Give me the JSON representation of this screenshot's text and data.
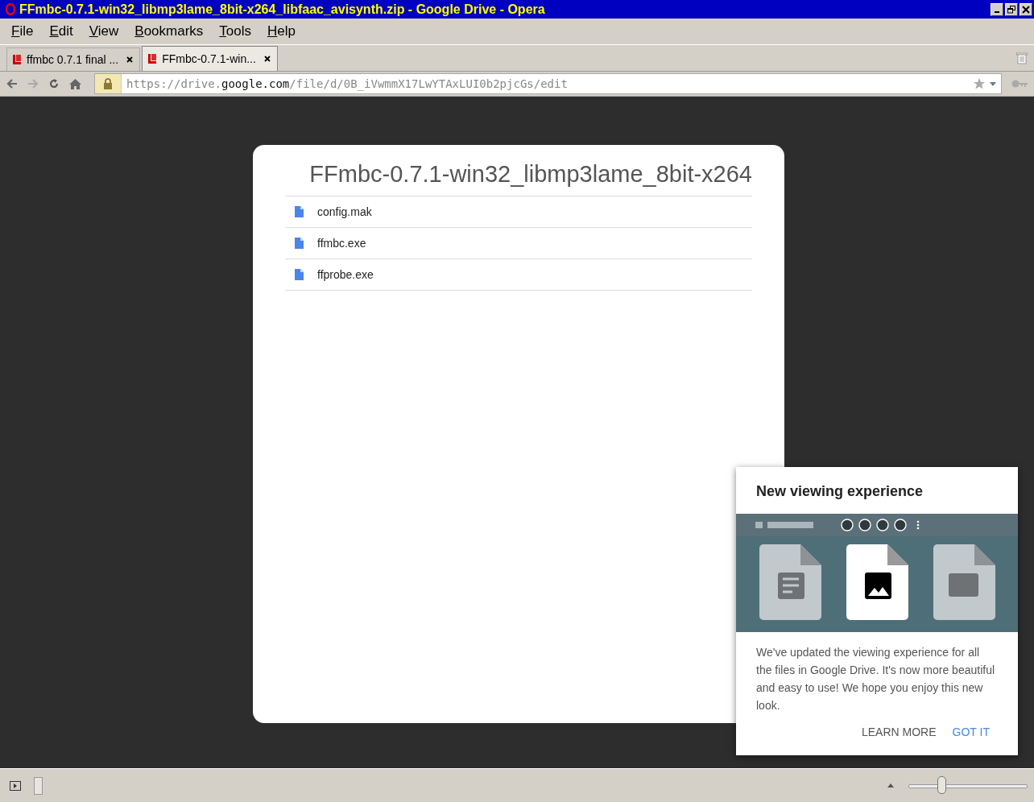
{
  "window": {
    "title": "FFmbc-0.7.1-win32_libmp3lame_8bit-x264_libfaac_avisynth.zip - Google Drive - Opera"
  },
  "menu": [
    "File",
    "Edit",
    "View",
    "Bookmarks",
    "Tools",
    "Help"
  ],
  "tabs": [
    {
      "label": "ffmbc 0.7.1 final ...",
      "selected": false
    },
    {
      "label": "FFmbc-0.7.1-win...",
      "selected": true
    }
  ],
  "address": {
    "url": "https://drive.**google.com**/file/d/0B_iVwmmX17LwYTAxLUI0b2pjcGs/edit"
  },
  "viewer": {
    "title": "FFmbc-0.7.1-win32_libmp3lame_8bit-x264",
    "files": [
      "config.mak",
      "ffmbc.exe",
      "ffprobe.exe"
    ]
  },
  "popup": {
    "title": "New viewing experience",
    "body": "We've updated the viewing experience for all the files in Google Drive. It's now more beautiful and easy to use! We hope you enjoy this new look.",
    "buttons": [
      {
        "label": "LEARN MORE",
        "kind": "plain"
      },
      {
        "label": "GOT IT",
        "kind": "primary"
      }
    ]
  },
  "status_bar": {
    "zoom": {
      "level": 0.28
    }
  }
}
